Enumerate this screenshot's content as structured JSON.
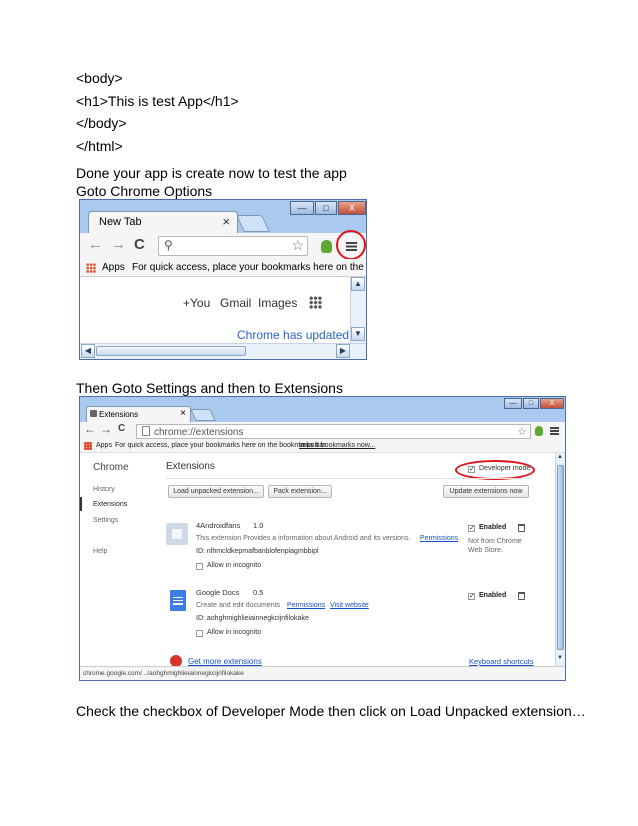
{
  "doc": {
    "code_lines": [
      "<body>",
      "<h1>This is test App</h1>",
      "</body>",
      "</html>"
    ],
    "text_done": "Done your app is create now to test the app",
    "text_goto_options": "Goto Chrome Options",
    "text_then_settings": "Then Goto Settings and then to Extensions",
    "text_check": "Check the checkbox of Developer Mode then click on Load Unpacked extension…"
  },
  "shot1": {
    "tab_title": "New Tab",
    "tab_close": "×",
    "win_minimize": "—",
    "win_maximize": "□",
    "win_close": "X",
    "nav_back": "←",
    "nav_forward": "→",
    "nav_reload": "C",
    "search_icon": "search-icon",
    "star_icon": "star-icon",
    "apps_label": "Apps",
    "bookmarks_hint": "For quick access, place your bookmarks here on the bo...",
    "plus_you": "+You",
    "gmail": "Gmail",
    "images": "Images",
    "update_notice": "Chrome has updated",
    "accent_color": "#e0141c"
  },
  "shot2": {
    "tab_title": "Extensions",
    "tab_close": "×",
    "win_minimize": "—",
    "win_maximize": "□",
    "win_close": "X",
    "nav_back": "←",
    "nav_forward": "→",
    "nav_reload": "C",
    "url": "chrome://extensions",
    "apps_label": "Apps",
    "bookmarks_hint": "For quick access, place your bookmarks here on the bookmarks bar.",
    "import_link": "Import bookmarks now...",
    "sidebar_title": "Chrome",
    "sidebar_items": [
      "History",
      "Extensions",
      "Settings",
      "",
      "Help"
    ],
    "page_title": "Extensions",
    "developer_mode": "Developer mode",
    "load_unpacked": "Load unpacked extension...",
    "pack_extension": "Pack extension...",
    "update_now": "Update extensions now",
    "extensions": [
      {
        "name": "4Androidfans",
        "version": "1.0",
        "description": "This extension Provides a information about Android and its versions.",
        "links": [
          "Permissions"
        ],
        "id": "ID: nlhmcldkepmafbanblofenpiagmbbipl",
        "incognito": "Allow in incognito",
        "enabled": "Enabled",
        "note": "Not from Chrome Web Store."
      },
      {
        "name": "Google Docs",
        "version": "0.5",
        "description": "Create and edit documents",
        "links": [
          "Permissions",
          "Visit website"
        ],
        "id": "ID: aohghmighlieiainnegkcijnfilokake",
        "incognito": "Allow in incognito",
        "enabled": "Enabled",
        "note": ""
      }
    ],
    "get_more": "Get more extensions",
    "keyboard_shortcuts": "Keyboard shortcuts",
    "status_url": "chrome.google.com/.../aohghmighlieiainnegkcijnfilokake",
    "accent_color": "#e0141c"
  }
}
